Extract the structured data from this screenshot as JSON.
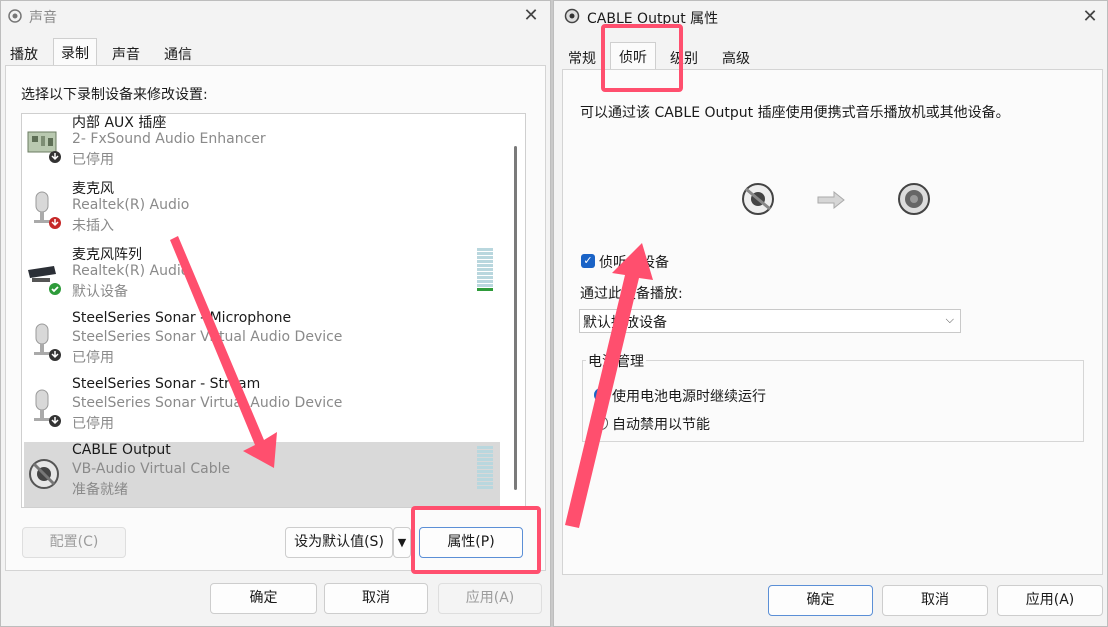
{
  "left_dialog": {
    "title": "声音",
    "tabs": [
      "播放",
      "录制",
      "声音",
      "通信"
    ],
    "instruction": "选择以下录制设备来修改设置:",
    "devices": [
      {
        "name": "内部 AUX 插座",
        "desc": "2- FxSound Audio Enhancer",
        "status": "已停用",
        "state": "disabled",
        "level_bars": 0
      },
      {
        "name": "麦克风",
        "desc": "Realtek(R) Audio",
        "status": "未插入",
        "state": "unplugged",
        "level_bars": 0
      },
      {
        "name": "麦克风阵列",
        "desc": "Realtek(R) Audio",
        "status": "默认设备",
        "state": "default",
        "level_bars": 10
      },
      {
        "name": "SteelSeries Sonar - Microphone",
        "desc": "SteelSeries Sonar Virtual Audio Device",
        "status": "已停用",
        "state": "disabled",
        "level_bars": 0
      },
      {
        "name": "SteelSeries Sonar - Stream",
        "desc": "SteelSeries Sonar Virtual Audio Device",
        "status": "已停用",
        "state": "disabled",
        "level_bars": 0
      },
      {
        "name": "CABLE Output",
        "desc": "VB-Audio Virtual Cable",
        "status": "准备就绪",
        "state": "ready",
        "level_bars": 10
      }
    ],
    "configure_label": "配置(C)",
    "set_default_label": "设为默认值(S)",
    "properties_label": "属性(P)",
    "ok_label": "确定",
    "cancel_label": "取消",
    "apply_label": "应用(A)"
  },
  "right_dialog": {
    "title": "CABLE Output 属性",
    "tabs": [
      "常规",
      "侦听",
      "级别",
      "高级"
    ],
    "description": "可以通过该 CABLE Output 插座使用便携式音乐播放机或其他设备。",
    "listen_checkbox_label": "侦听此设备",
    "listen_checked": true,
    "playback_label": "通过此设备播放:",
    "playback_value": "默认播放设备",
    "power_group_label": "电源管理",
    "power_options": [
      {
        "label": "使用电池电源时继续运行",
        "checked": true
      },
      {
        "label": "自动禁用以节能",
        "checked": false
      }
    ],
    "ok_label": "确定",
    "cancel_label": "取消",
    "apply_label": "应用(A)"
  },
  "colors": {
    "highlight": "#ff4f6e",
    "accent": "#1a63c6"
  }
}
